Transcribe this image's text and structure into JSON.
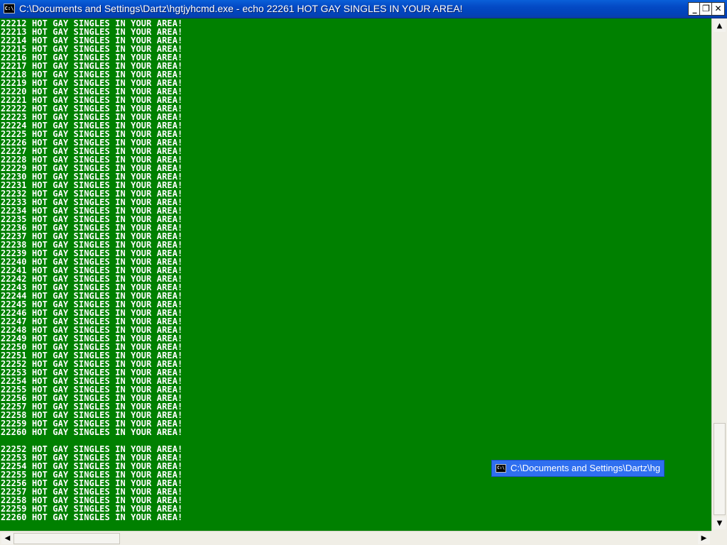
{
  "window": {
    "title": "C:\\Documents and Settings\\Dartz\\hgtjyhcmd.exe - echo 22261 HOT GAY SINGLES IN YOUR AREA!",
    "icon": "console-icon",
    "icon_text": "C:\\",
    "buttons": {
      "minimize": "_",
      "maximize": "❐",
      "close": "✕"
    }
  },
  "console": {
    "lines": [
      "22212 HOT GAY SINGLES IN YOUR AREA!",
      "22213 HOT GAY SINGLES IN YOUR AREA!",
      "22214 HOT GAY SINGLES IN YOUR AREA!",
      "22215 HOT GAY SINGLES IN YOUR AREA!",
      "22216 HOT GAY SINGLES IN YOUR AREA!",
      "22217 HOT GAY SINGLES IN YOUR AREA!",
      "22218 HOT GAY SINGLES IN YOUR AREA!",
      "22219 HOT GAY SINGLES IN YOUR AREA!",
      "22220 HOT GAY SINGLES IN YOUR AREA!",
      "22221 HOT GAY SINGLES IN YOUR AREA!",
      "22222 HOT GAY SINGLES IN YOUR AREA!",
      "22223 HOT GAY SINGLES IN YOUR AREA!",
      "22224 HOT GAY SINGLES IN YOUR AREA!",
      "22225 HOT GAY SINGLES IN YOUR AREA!",
      "22226 HOT GAY SINGLES IN YOUR AREA!",
      "22227 HOT GAY SINGLES IN YOUR AREA!",
      "22228 HOT GAY SINGLES IN YOUR AREA!",
      "22229 HOT GAY SINGLES IN YOUR AREA!",
      "22230 HOT GAY SINGLES IN YOUR AREA!",
      "22231 HOT GAY SINGLES IN YOUR AREA!",
      "22232 HOT GAY SINGLES IN YOUR AREA!",
      "22233 HOT GAY SINGLES IN YOUR AREA!",
      "22234 HOT GAY SINGLES IN YOUR AREA!",
      "22235 HOT GAY SINGLES IN YOUR AREA!",
      "22236 HOT GAY SINGLES IN YOUR AREA!",
      "22237 HOT GAY SINGLES IN YOUR AREA!",
      "22238 HOT GAY SINGLES IN YOUR AREA!",
      "22239 HOT GAY SINGLES IN YOUR AREA!",
      "22240 HOT GAY SINGLES IN YOUR AREA!",
      "22241 HOT GAY SINGLES IN YOUR AREA!",
      "22242 HOT GAY SINGLES IN YOUR AREA!",
      "22243 HOT GAY SINGLES IN YOUR AREA!",
      "22244 HOT GAY SINGLES IN YOUR AREA!",
      "22245 HOT GAY SINGLES IN YOUR AREA!",
      "22246 HOT GAY SINGLES IN YOUR AREA!",
      "22247 HOT GAY SINGLES IN YOUR AREA!",
      "22248 HOT GAY SINGLES IN YOUR AREA!",
      "22249 HOT GAY SINGLES IN YOUR AREA!",
      "22250 HOT GAY SINGLES IN YOUR AREA!",
      "22251 HOT GAY SINGLES IN YOUR AREA!",
      "22252 HOT GAY SINGLES IN YOUR AREA!",
      "22253 HOT GAY SINGLES IN YOUR AREA!",
      "22254 HOT GAY SINGLES IN YOUR AREA!",
      "22255 HOT GAY SINGLES IN YOUR AREA!",
      "22256 HOT GAY SINGLES IN YOUR AREA!",
      "22257 HOT GAY SINGLES IN YOUR AREA!",
      "22258 HOT GAY SINGLES IN YOUR AREA!",
      "22259 HOT GAY SINGLES IN YOUR AREA!",
      "22260 HOT GAY SINGLES IN YOUR AREA!",
      "",
      "22252 HOT GAY SINGLES IN YOUR AREA!",
      "22253 HOT GAY SINGLES IN YOUR AREA!",
      "22254 HOT GAY SINGLES IN YOUR AREA!",
      "22255 HOT GAY SINGLES IN YOUR AREA!",
      "22256 HOT GAY SINGLES IN YOUR AREA!",
      "22257 HOT GAY SINGLES IN YOUR AREA!",
      "22258 HOT GAY SINGLES IN YOUR AREA!",
      "22259 HOT GAY SINGLES IN YOUR AREA!",
      "22260 HOT GAY SINGLES IN YOUR AREA!"
    ],
    "background_color": "#008000",
    "text_color": "#ffffff"
  },
  "scrollbars": {
    "vertical": {
      "up_icon": "▲",
      "down_icon": "▼",
      "position": 0.94
    },
    "horizontal": {
      "left_icon": "◀",
      "right_icon": "▶",
      "position": 0
    }
  },
  "taskbar_tooltip": {
    "icon_text": "C:\\",
    "text": "C:\\Documents and Settings\\Dartz\\hg"
  },
  "colors": {
    "titlebar": "#0349c4",
    "tooltip": "#2f6ff0"
  }
}
